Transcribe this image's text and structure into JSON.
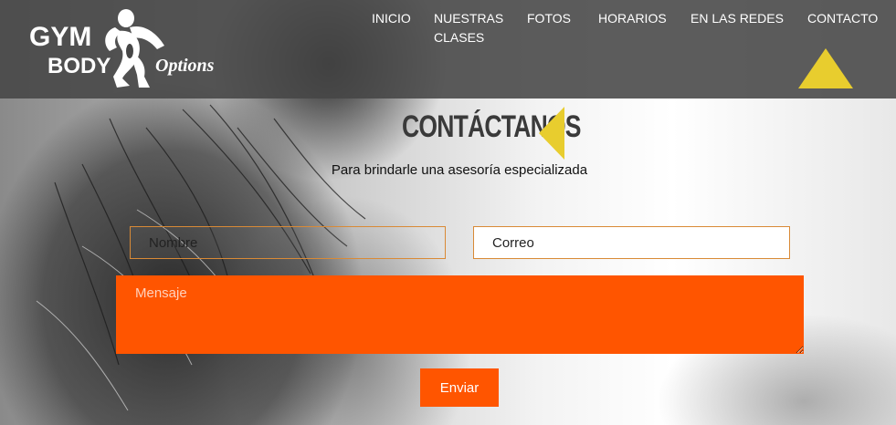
{
  "brand": {
    "line1": "GYM",
    "line2": "BODY",
    "line3": "Options"
  },
  "nav": {
    "items": [
      {
        "label": "INICIO"
      },
      {
        "label": "NUESTRAS CLASES"
      },
      {
        "label": "FOTOS"
      },
      {
        "label": "HORARIOS"
      },
      {
        "label": "EN LAS REDES"
      },
      {
        "label": "CONTACTO"
      }
    ],
    "active": "CONTACTO"
  },
  "contact": {
    "title": "CONTÁCTANOS",
    "subtitle": "Para brindarle una asesoría especializada",
    "name_placeholder": "Nombre",
    "email_placeholder": "Correo",
    "message_placeholder": "Mensaje",
    "send_label": "Enviar"
  },
  "colors": {
    "header_bg": "#464646",
    "accent_orange": "#ff5500",
    "accent_yellow": "#e8cd2e",
    "field_border": "#d98a36"
  },
  "icons": {
    "active_nav_marker": "triangle-up-icon",
    "title_marker": "triangle-left-icon"
  }
}
